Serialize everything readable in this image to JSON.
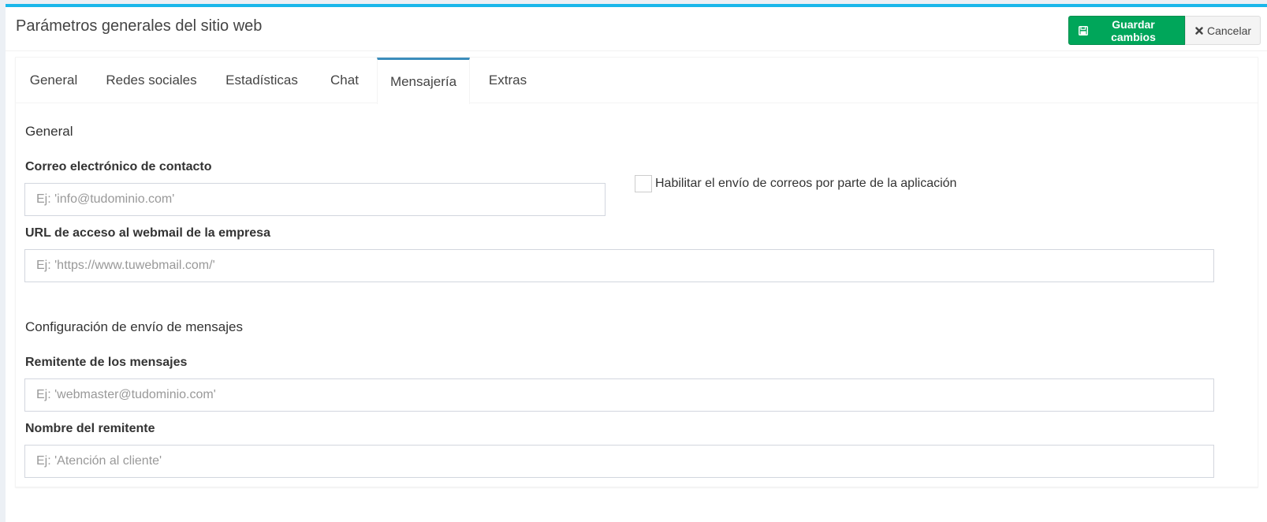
{
  "header": {
    "title": "Parámetros generales del sitio web",
    "save_label": "Guardar cambios",
    "save_icon": "floppy-disk-icon",
    "cancel_label": "Cancelar",
    "cancel_icon": "times-icon"
  },
  "tabs": [
    {
      "label": "General",
      "active": false
    },
    {
      "label": "Redes sociales",
      "active": false
    },
    {
      "label": "Estadísticas",
      "active": false
    },
    {
      "label": "Chat",
      "active": false
    },
    {
      "label": "Mensajería",
      "active": true
    },
    {
      "label": "Extras",
      "active": false
    }
  ],
  "sections": {
    "general_title": "General",
    "sending_title": "Configuración de envío de mensajes"
  },
  "fields": {
    "contact_email": {
      "label": "Correo electrónico de contacto",
      "placeholder": "Ej: 'info@tudominio.com'",
      "value": ""
    },
    "enable_emails": {
      "label": "Habilitar el envío de correos por parte de la aplicación",
      "checked": false
    },
    "webmail_url": {
      "label": "URL de acceso al webmail de la empresa",
      "placeholder": "Ej: 'https://www.tuwebmail.com/'",
      "value": ""
    },
    "sender": {
      "label": "Remitente de los mensajes",
      "placeholder": "Ej: 'webmaster@tudominio.com'",
      "value": ""
    },
    "sender_name": {
      "label": "Nombre del remitente",
      "placeholder": "Ej: 'Atención al cliente'",
      "value": ""
    }
  },
  "colors": {
    "accent_top_border": "#1ab7ea",
    "save_button": "#00a65a",
    "active_tab_border": "#3c8dbc"
  }
}
